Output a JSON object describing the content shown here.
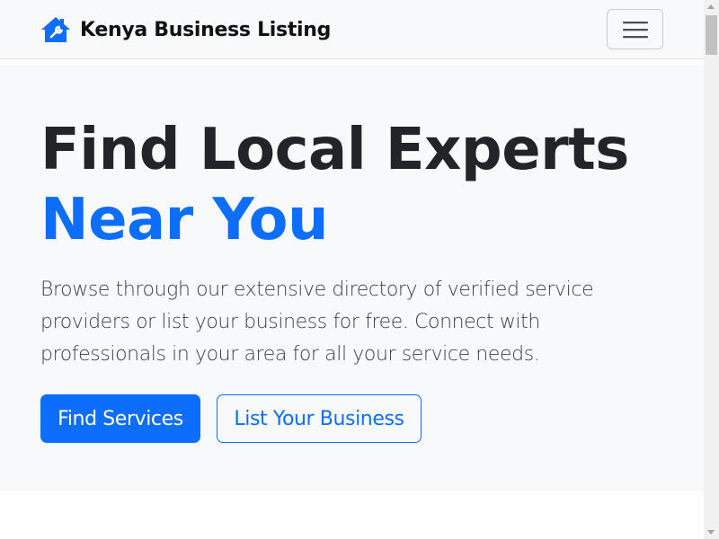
{
  "navbar": {
    "brand_text": "Kenya Business Listing",
    "brand_icon": "house-wrench-icon",
    "toggler_icon": "hamburger-menu-icon"
  },
  "hero": {
    "headline_line1": "Find Local Experts",
    "headline_line2": "Near You",
    "lead": "Browse through our extensive directory of verified service providers or list your business for free. Connect with professionals in your area for all your service needs.",
    "primary_button": "Find Services",
    "secondary_button": "List Your Business"
  },
  "colors": {
    "accent": "#0d6efd",
    "hero_background": "#f8f9fa",
    "text_dark": "#212529"
  }
}
